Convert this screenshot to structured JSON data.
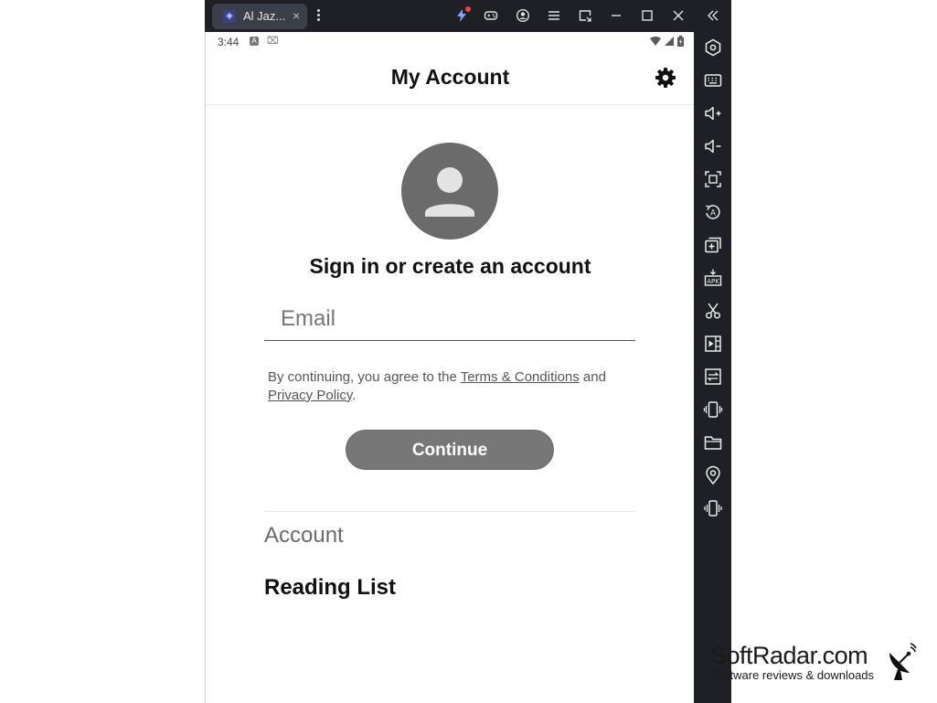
{
  "titlebar": {
    "tab_label": "Al Jaz...",
    "tab_close": "×",
    "buttons": [
      "lightning-icon",
      "gamepad-icon",
      "account-circle-icon",
      "hamburger-menu-icon",
      "resize-icon",
      "minimize-icon",
      "maximize-icon",
      "close-icon"
    ]
  },
  "status_bar": {
    "time": "3:44",
    "a_badge": "A",
    "extra": "⌧"
  },
  "app": {
    "title": "My Account",
    "headline": "Sign in or create an account",
    "email_placeholder": "Email",
    "terms_prefix": "By continuing, you agree to the ",
    "terms_link": "Terms & Conditions",
    "terms_and": " and ",
    "privacy_link": "Privacy Policy",
    "terms_suffix": ".",
    "continue_label": "Continue",
    "section_label": "Account",
    "reading_list_label": "Reading List"
  },
  "sidebar_icons": [
    "collapse-icon",
    "settings-hex-icon",
    "keyboard-icon",
    "volume-up-icon",
    "volume-down-icon",
    "screenshot-icon",
    "rotate-icon",
    "multi-instance-icon",
    "apk-icon",
    "scissors-icon",
    "record-icon",
    "macro-icon",
    "shake-icon",
    "folder-icon",
    "location-icon",
    "vibrate-icon"
  ],
  "watermark": {
    "title": "SoftRadar.com",
    "subtitle": "Software reviews & downloads"
  },
  "colors": {
    "titlebar_bg": "#1e2026",
    "button_gray": "#777777",
    "avatar_gray": "#6b6b6b",
    "notification_red": "#ef4444"
  }
}
